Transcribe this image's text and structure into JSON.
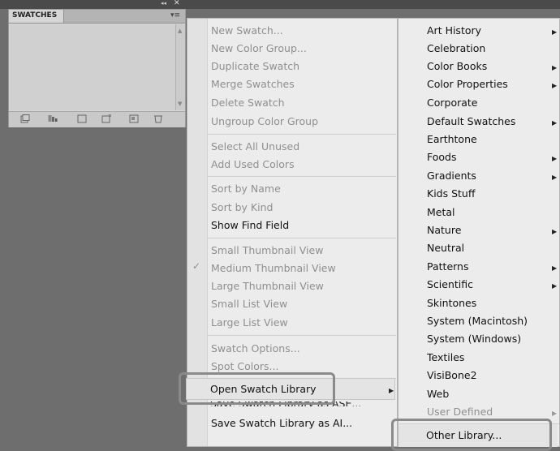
{
  "panel": {
    "tab_label": "SWATCHES",
    "collapse_glyph": "◂◂",
    "close_glyph": "✕",
    "menu_glyph": "▾≡",
    "bottom_icons": [
      "swatch-libraries-icon",
      "show-kinds-icon",
      "swatch-options-icon",
      "new-color-group-icon",
      "new-swatch-icon",
      "delete-swatch-icon"
    ]
  },
  "menu": {
    "items": [
      {
        "label": "New Swatch...",
        "state": "disabled"
      },
      {
        "label": "New Color Group...",
        "state": "disabled"
      },
      {
        "label": "Duplicate Swatch",
        "state": "disabled"
      },
      {
        "label": "Merge Swatches",
        "state": "disabled"
      },
      {
        "label": "Delete Swatch",
        "state": "disabled"
      },
      {
        "label": "Ungroup Color Group",
        "state": "disabled"
      },
      {
        "label": "Select All Unused",
        "state": "disabled"
      },
      {
        "label": "Add Used Colors",
        "state": "disabled"
      },
      {
        "label": "Sort by Name",
        "state": "disabled"
      },
      {
        "label": "Sort by Kind",
        "state": "disabled"
      },
      {
        "label": "Show Find Field",
        "state": "enabled"
      },
      {
        "label": "Small Thumbnail View",
        "state": "disabled",
        "checked": true
      },
      {
        "label": "Medium Thumbnail View",
        "state": "disabled"
      },
      {
        "label": "Large Thumbnail View",
        "state": "disabled"
      },
      {
        "label": "Small List View",
        "state": "disabled"
      },
      {
        "label": "Large List View",
        "state": "disabled"
      },
      {
        "label": "Swatch Options...",
        "state": "disabled"
      },
      {
        "label": "Spot Colors...",
        "state": "disabled"
      },
      {
        "label": "Open Swatch Library",
        "state": "enabled",
        "submenu": true,
        "highlighted": true
      },
      {
        "label": "Save Swatch Library as ASE...",
        "state": "enabled"
      },
      {
        "label": "Save Swatch Library as AI...",
        "state": "enabled"
      }
    ],
    "check_glyph": "✓",
    "arrow_glyph": "▶"
  },
  "submenu": {
    "items": [
      {
        "label": "Art History",
        "arrow": true
      },
      {
        "label": "Celebration",
        "arrow": false
      },
      {
        "label": "Color Books",
        "arrow": true
      },
      {
        "label": "Color Properties",
        "arrow": true
      },
      {
        "label": "Corporate",
        "arrow": false
      },
      {
        "label": "Default Swatches",
        "arrow": true
      },
      {
        "label": "Earthtone",
        "arrow": false
      },
      {
        "label": "Foods",
        "arrow": true
      },
      {
        "label": "Gradients",
        "arrow": true
      },
      {
        "label": "Kids Stuff",
        "arrow": false
      },
      {
        "label": "Metal",
        "arrow": false
      },
      {
        "label": "Nature",
        "arrow": true
      },
      {
        "label": "Neutral",
        "arrow": false
      },
      {
        "label": "Patterns",
        "arrow": true
      },
      {
        "label": "Scientific",
        "arrow": true
      },
      {
        "label": "Skintones",
        "arrow": false
      },
      {
        "label": "System (Macintosh)",
        "arrow": false
      },
      {
        "label": "System (Windows)",
        "arrow": false
      },
      {
        "label": "Textiles",
        "arrow": false
      },
      {
        "label": "VisiBone2",
        "arrow": false
      },
      {
        "label": "Web",
        "arrow": false
      },
      {
        "label": "User Defined",
        "arrow": true,
        "disabled": true
      },
      {
        "label": "Other Library...",
        "arrow": false,
        "highlighted": true
      }
    ]
  },
  "colors": {
    "background": "#6e6e6e",
    "menu_bg": "#ececec",
    "disabled_text": "#8f8f8f",
    "highlight_border": "#8a8a8a"
  }
}
